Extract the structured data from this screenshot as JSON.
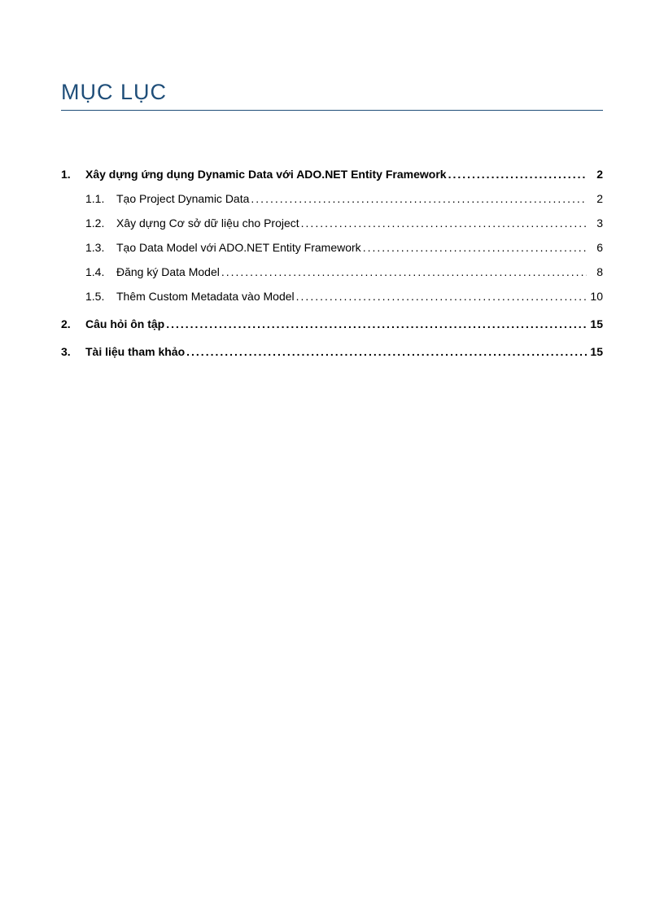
{
  "title": "MỤC LỤC",
  "toc": [
    {
      "level": 1,
      "num": "1.",
      "text": "Xây dựng ứng dụng Dynamic Data với ADO.NET Entity Framework",
      "page": "2"
    },
    {
      "level": 2,
      "num": "1.1.",
      "text": "Tạo Project Dynamic Data",
      "page": "2"
    },
    {
      "level": 2,
      "num": "1.2.",
      "text": "Xây dựng Cơ sở dữ liệu cho Project",
      "page": "3"
    },
    {
      "level": 2,
      "num": "1.3.",
      "text": "Tạo Data Model với ADO.NET Entity Framework",
      "page": "6"
    },
    {
      "level": 2,
      "num": "1.4.",
      "text": "Đăng ký Data Model",
      "page": "8"
    },
    {
      "level": 2,
      "num": "1.5.",
      "text": "Thêm Custom Metadata vào Model",
      "page": "10"
    },
    {
      "level": 1,
      "num": "2.",
      "text": "Câu hỏi ôn tập",
      "page": "15"
    },
    {
      "level": 1,
      "num": "3.",
      "text": "Tài liệu tham khảo",
      "page": "15"
    }
  ]
}
